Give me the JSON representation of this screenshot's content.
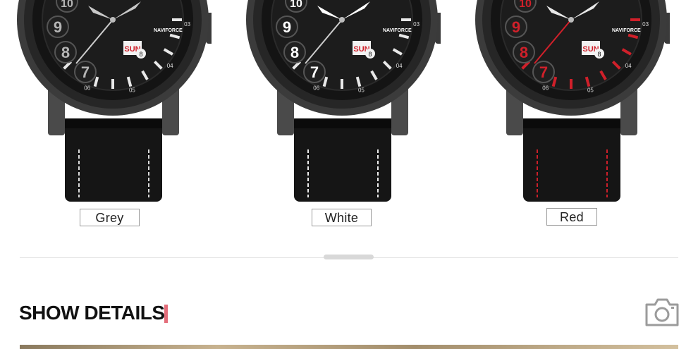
{
  "products": [
    {
      "id": "grey",
      "label": "Grey",
      "accent": "#c8c8c8",
      "stitch": "#d9d9d9",
      "numerals": [
        "10",
        "9",
        "8",
        "7"
      ],
      "day": "SUN",
      "date": "8",
      "brand": "NAVIFORCE",
      "indices": [
        "03",
        "04",
        "05",
        "06"
      ]
    },
    {
      "id": "white",
      "label": "White",
      "accent": "#ffffff",
      "stitch": "#ececec",
      "numerals": [
        "10",
        "9",
        "8",
        "7"
      ],
      "day": "SUN",
      "date": "8",
      "brand": "NAVIFORCE",
      "indices": [
        "03",
        "04",
        "05",
        "06"
      ]
    },
    {
      "id": "red",
      "label": "Red",
      "accent": "#d0202a",
      "stitch": "#cc1f2a",
      "numerals": [
        "10",
        "9",
        "8",
        "7"
      ],
      "day": "SUN",
      "date": "8",
      "brand": "NAVIFORCE",
      "indices": [
        "03",
        "04",
        "05",
        "06"
      ]
    }
  ],
  "section": {
    "title": "SHOW DETAILS",
    "accent_color": "#e46d7a",
    "icon": "camera-icon"
  }
}
